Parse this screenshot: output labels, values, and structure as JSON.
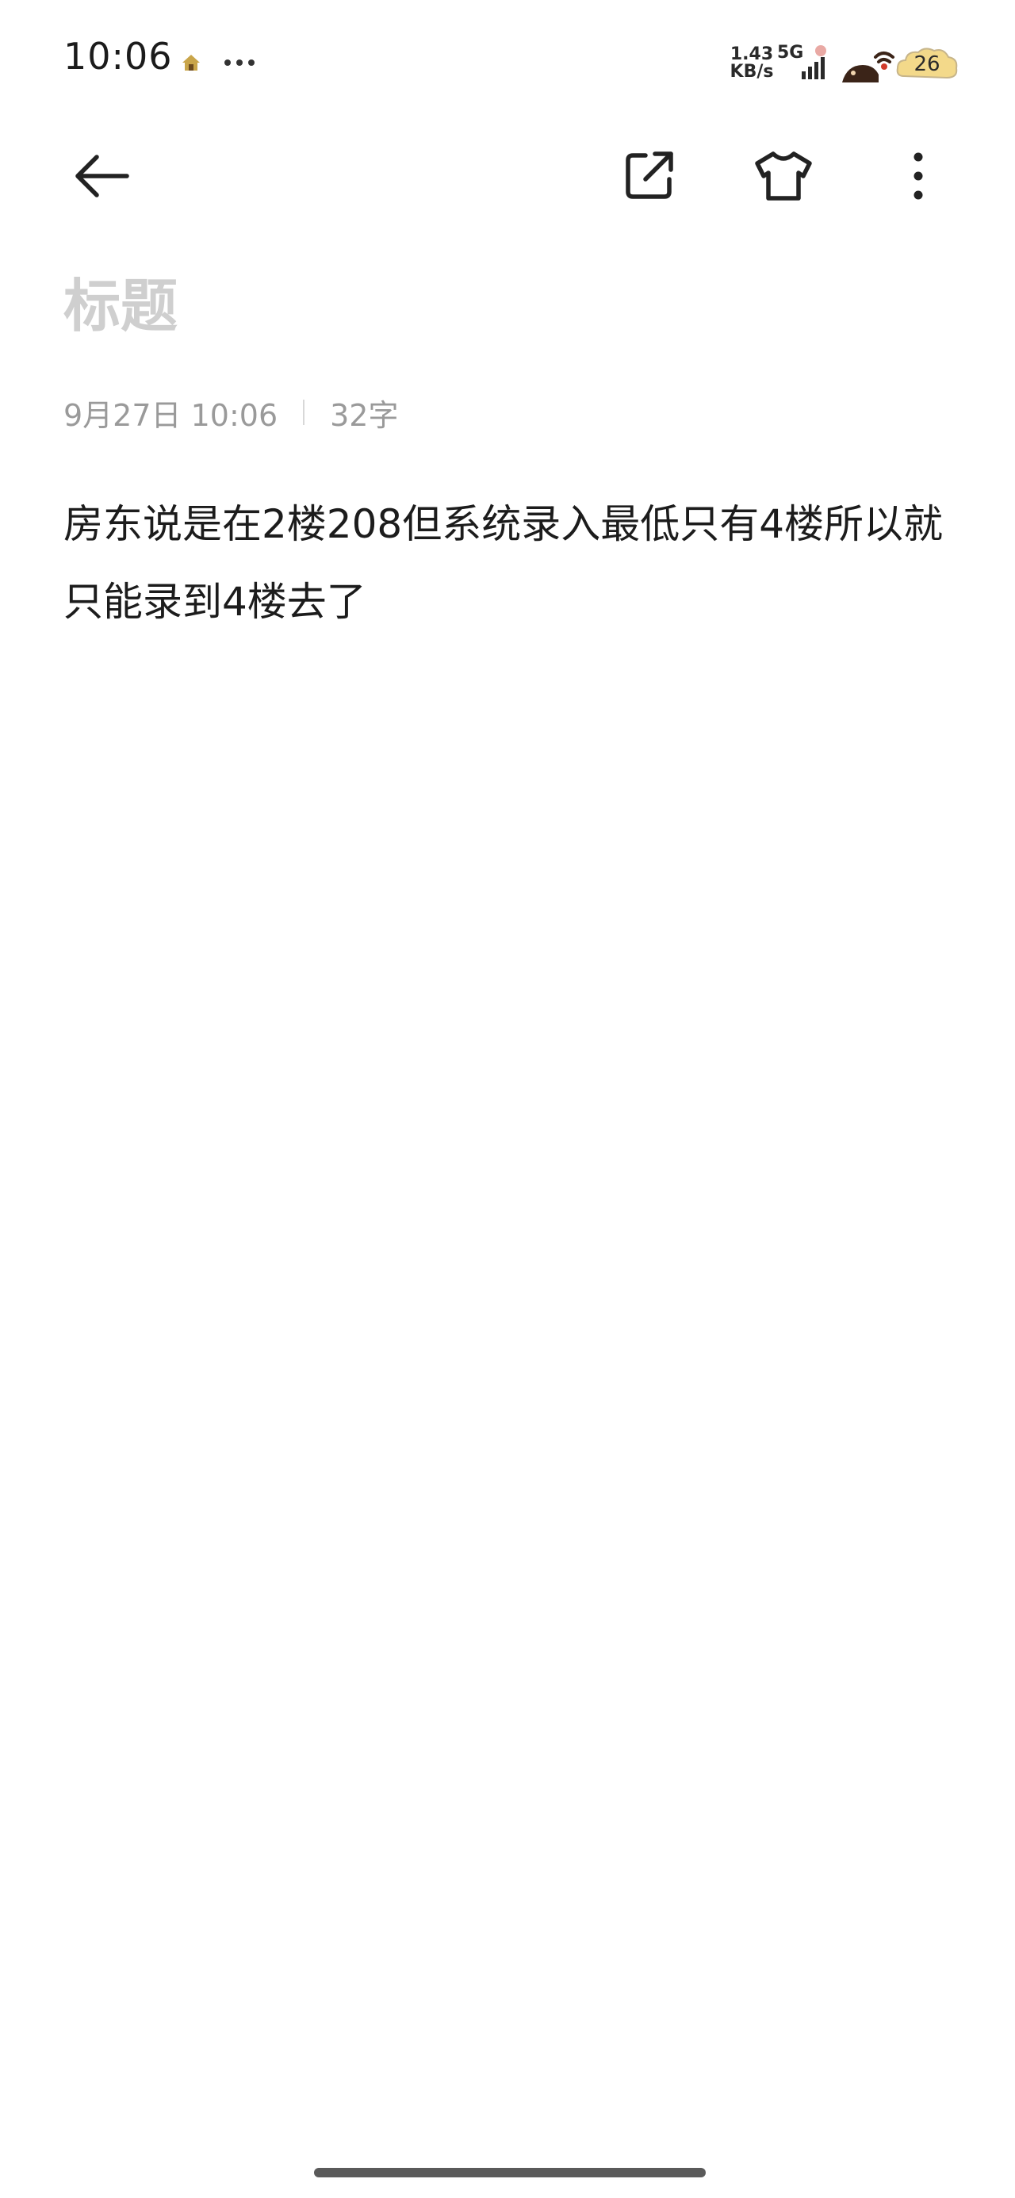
{
  "status_bar": {
    "time": "10:06",
    "net_speed_value": "1.43",
    "net_speed_unit": "KB/s",
    "network_type": "5G",
    "battery_level": "26",
    "icons": [
      "home-icon",
      "more-dots-icon",
      "signal-icon",
      "wifi-icon",
      "battery-icon"
    ]
  },
  "toolbar": {
    "icons": [
      "back-arrow-icon",
      "share-icon",
      "t-shirt-icon",
      "more-vertical-icon"
    ]
  },
  "note": {
    "title_placeholder": "标题",
    "date": "9月27日 10:06",
    "word_count": "32字",
    "body": "房东说是在2楼208但系统录入最低只有4楼所以就只能录到4楼去了"
  },
  "colors": {
    "background": "#ffffff",
    "text": "#1c1c1c",
    "placeholder": "#cfcfcf",
    "meta": "#9a9a9a"
  }
}
